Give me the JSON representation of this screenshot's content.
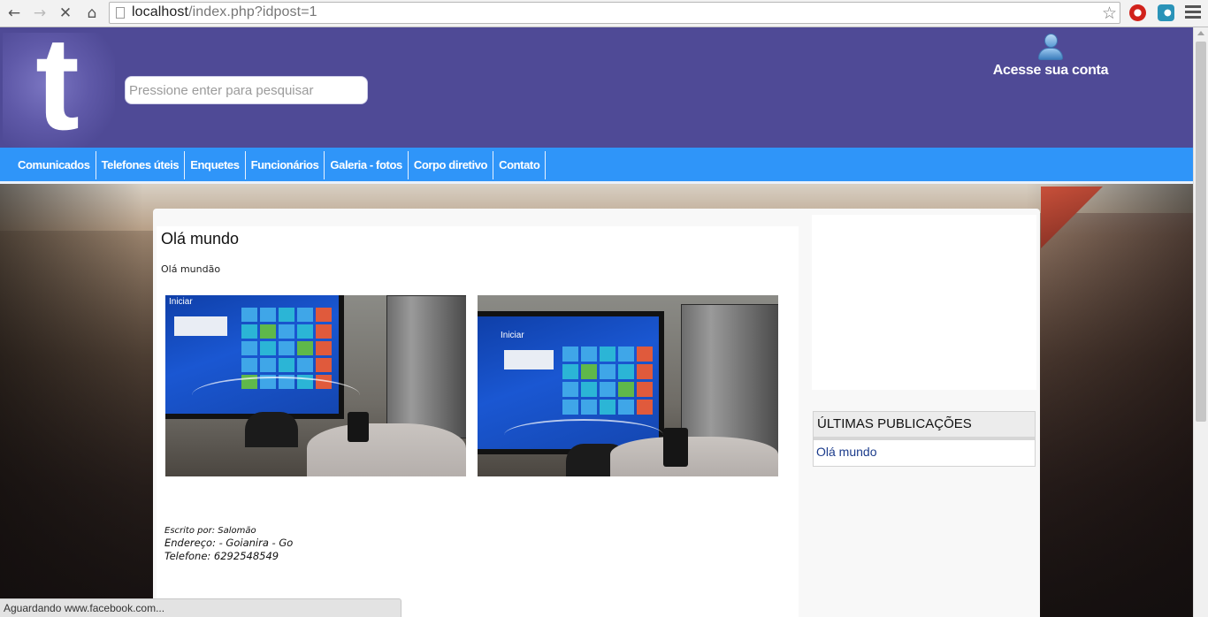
{
  "browser": {
    "url_host": "localhost",
    "url_path": "/index.php?idpost=1",
    "status_text": "Aguardando www.facebook.com..."
  },
  "header": {
    "logo_letter": "t",
    "search_placeholder": "Pressione enter para pesquisar",
    "account_label": "Acesse sua conta"
  },
  "nav": {
    "items": [
      "Comunicados",
      "Telefones úteis",
      "Enquetes",
      "Funcionários",
      "Galeria - fotos",
      "Corpo diretivo",
      "Contato"
    ]
  },
  "post": {
    "title": "Olá mundo",
    "body": "Olá mundão",
    "photo_caption_1": "Iniciar",
    "photo_caption_2": "Iniciar",
    "author": "Escrito por: Salomão",
    "address": "Endereço: - Goianira - Go",
    "phone": "Telefone: 6292548549"
  },
  "sidebar": {
    "recent_title": "ÚLTIMAS PUBLICAÇÕES",
    "recent_items": [
      "Olá mundo"
    ]
  },
  "colors": {
    "header_bg": "#4f4a96",
    "menu_bg": "#2f95f9",
    "link": "#1c3c8c"
  }
}
